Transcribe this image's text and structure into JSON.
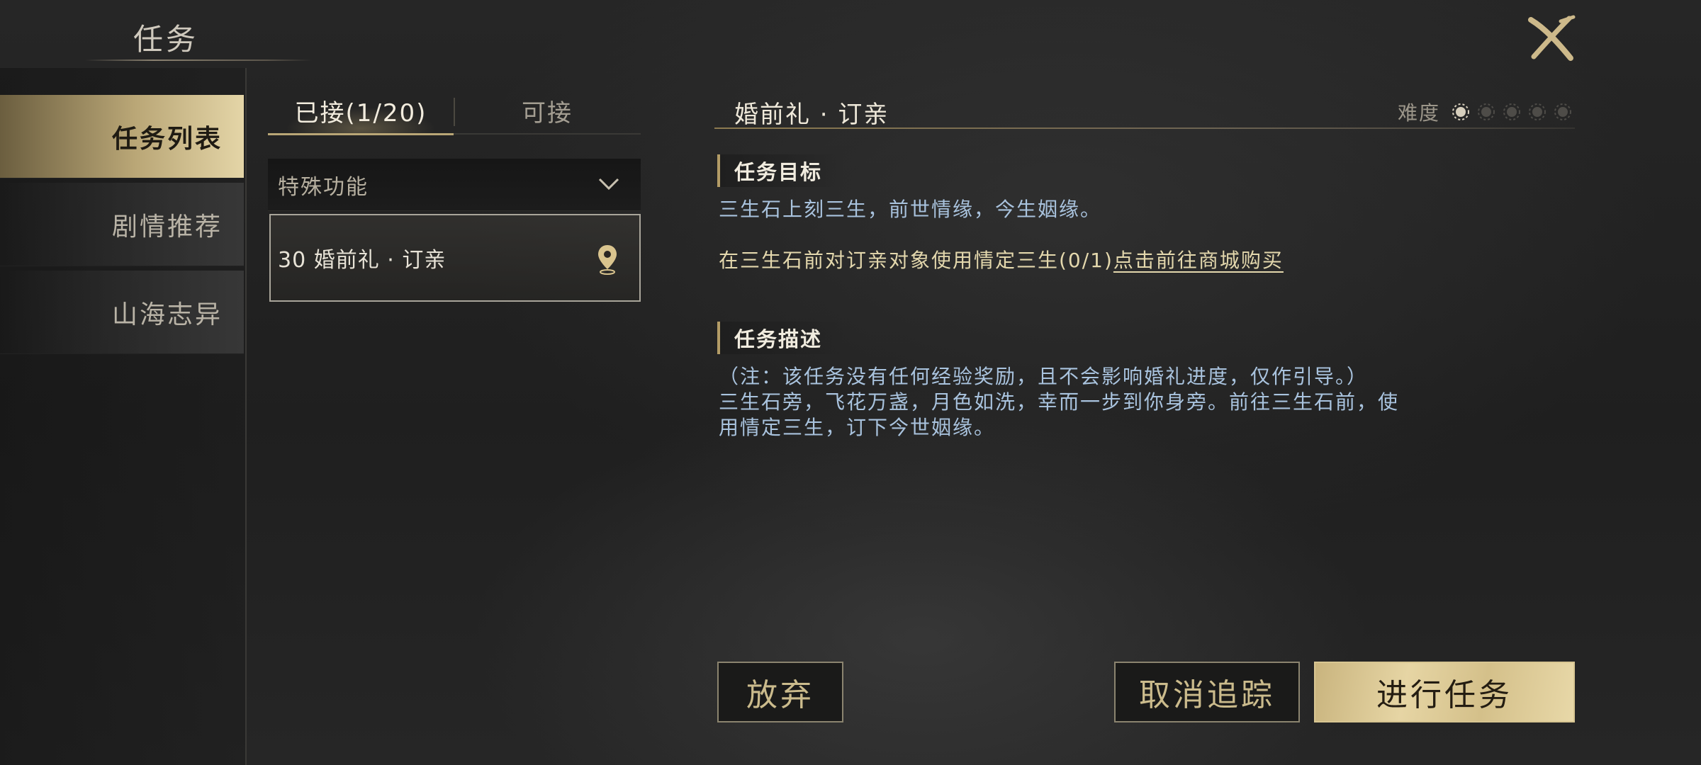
{
  "header": {
    "title": "任务"
  },
  "nav": {
    "items": [
      {
        "label": "任务列表",
        "active": true
      },
      {
        "label": "剧情推荐",
        "active": false
      },
      {
        "label": "山海志异",
        "active": false
      }
    ]
  },
  "tabs": {
    "accepted": "已接(1/20)",
    "available": "可接"
  },
  "group": {
    "label": "特殊功能"
  },
  "quest_item": {
    "label": "30 婚前礼 · 订亲"
  },
  "detail": {
    "title": "婚前礼 · 订亲",
    "difficulty_label": "难度",
    "difficulty_level": 1,
    "difficulty_max": 5,
    "objective_heading": "任务目标",
    "objective_text": "三生石上刻三生，前世情缘，今生姻缘。",
    "objective_task": "在三生石前对订亲对象使用情定三生(0/1)",
    "objective_link": "点击前往商城购买",
    "description_heading": "任务描述",
    "description_note": "（注：该任务没有任何经验奖励，且不会影响婚礼进度，仅作引导。）",
    "description_line1": "三生石旁，飞花万盏，月色如洗，幸而一步到你身旁。前往三生石前，使",
    "description_line2": "用情定三生，订下今世姻缘。"
  },
  "buttons": {
    "abandon": "放弃",
    "untrack": "取消追踪",
    "proceed": "进行任务"
  },
  "colors": {
    "accent_gold": "#b9a676",
    "text_blue": "#a9c3de",
    "text_gold": "#e4d8ad"
  }
}
